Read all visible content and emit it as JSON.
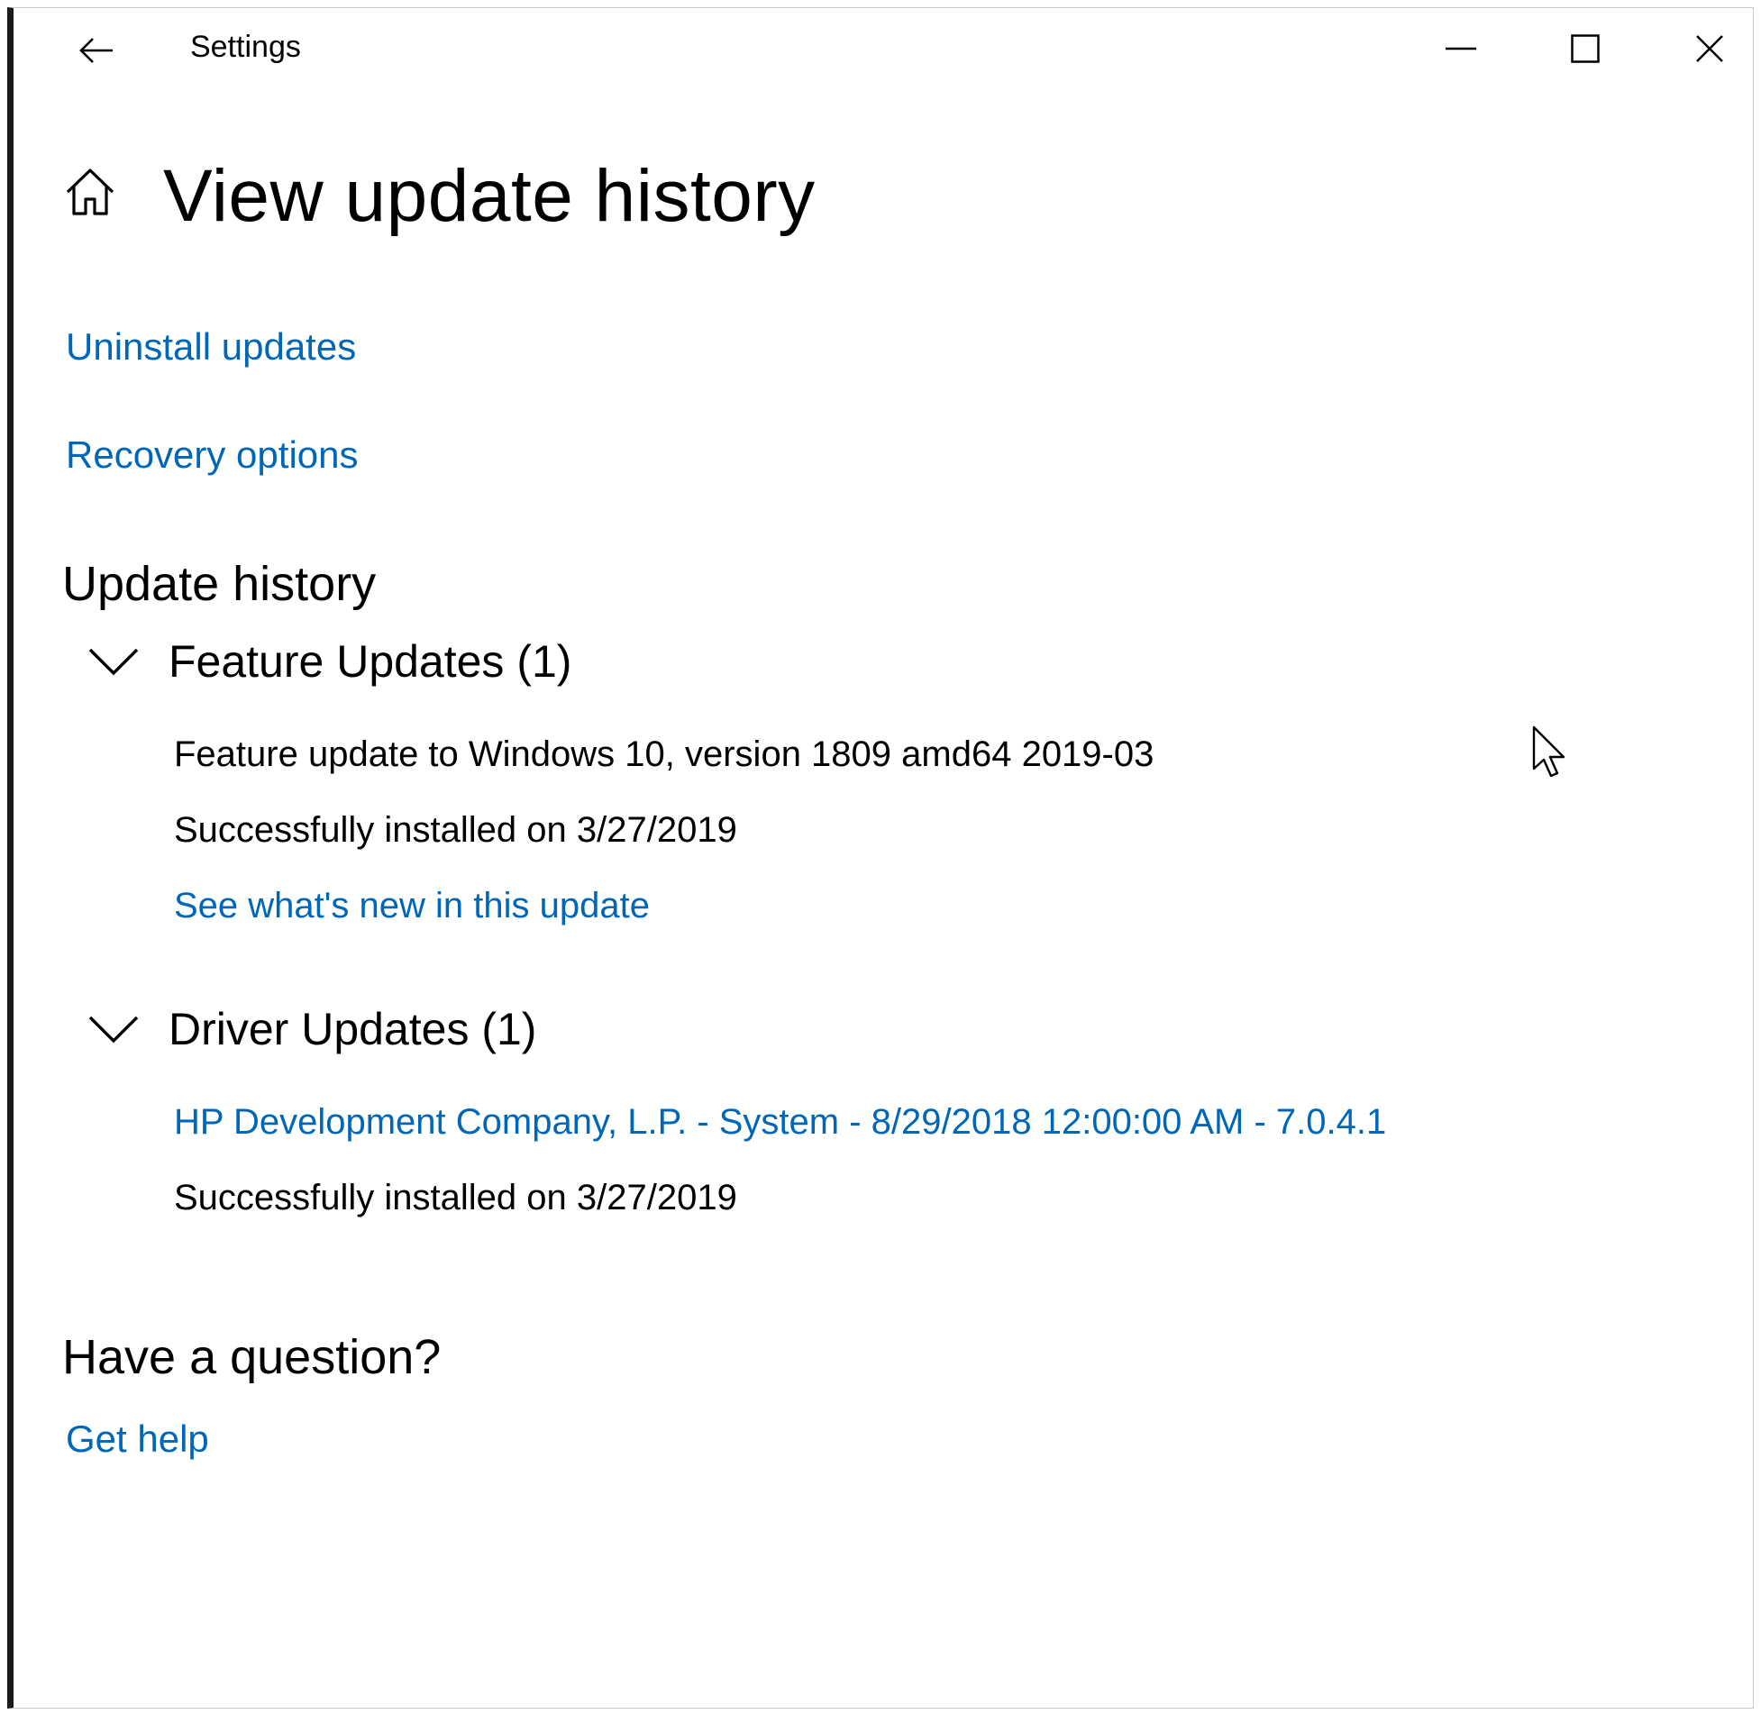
{
  "window": {
    "title": "Settings",
    "controls": {
      "minimize": "minimize-icon",
      "maximize": "maximize-icon",
      "close": "close-icon"
    }
  },
  "header": {
    "home_icon": "home-icon",
    "title": "View update history"
  },
  "links": {
    "uninstall": "Uninstall updates",
    "recovery": "Recovery options"
  },
  "update_history": {
    "heading": "Update history",
    "groups": [
      {
        "label": "Feature Updates (1)",
        "items": [
          {
            "name": "Feature update to Windows 10, version 1809 amd64 2019-03",
            "status": "Successfully installed on 3/27/2019",
            "link": "See what's new in this update"
          }
        ]
      },
      {
        "label": "Driver Updates (1)",
        "items": [
          {
            "name": "HP Development Company, L.P. - System - 8/29/2018 12:00:00 AM - 7.0.4.1",
            "status": "Successfully installed on 3/27/2019"
          }
        ]
      }
    ]
  },
  "help": {
    "heading": "Have a question?",
    "link": "Get help"
  },
  "colors": {
    "link": "#0067b8",
    "text": "#000000",
    "background": "#ffffff",
    "window_border": "#1b1b1b"
  }
}
